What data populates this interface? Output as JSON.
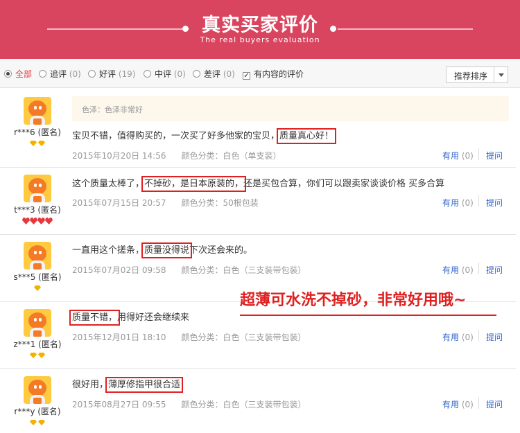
{
  "header": {
    "title": "真实买家评价",
    "subtitle": "The real buyers evaluation"
  },
  "filters": [
    {
      "label": "全部",
      "count": "",
      "selected": true
    },
    {
      "label": "追评",
      "count": "(0)",
      "selected": false
    },
    {
      "label": "好评",
      "count": "(19)",
      "selected": false
    },
    {
      "label": "中评",
      "count": "(0)",
      "selected": false
    },
    {
      "label": "差评",
      "count": "(0)",
      "selected": false
    }
  ],
  "content_filter": {
    "label": "有内容的评价",
    "checked": true
  },
  "sort": {
    "label": "推荐排序"
  },
  "reviews": [
    {
      "user": "r***6 (匿名)",
      "level": "diamond-2",
      "tag": "色泽：色泽非常好",
      "text_before": "宝贝不错，值得购买的，一次买了好多他家的宝贝，",
      "text_highlight": "质量真心好！",
      "text_after": "",
      "date": "2015年10月20日 14:56",
      "color": "颜色分类：白色（单支装）",
      "useful_label": "有用",
      "useful_count": "(0)",
      "reply_label": "提问"
    },
    {
      "user": "t***3 (匿名)",
      "level": "heart-4",
      "text_before": "这个质量太棒了，",
      "text_highlight": "不掉砂，是日本原装的，",
      "text_after": "还是买包合算，你们可以跟卖家谈谈价格 买多合算",
      "date": "2015年07月15日 20:57",
      "color": "颜色分类：50根包装",
      "useful_label": "有用",
      "useful_count": "(0)",
      "reply_label": "提问"
    },
    {
      "user": "s***5 (匿名)",
      "level": "diamond-1",
      "text_before": "一直用这个搓条，",
      "text_highlight": "质量没得说",
      "text_after": "下次还会来的。",
      "date": "2015年07月02日 09:58",
      "color": "颜色分类：白色（三支装带包装）",
      "useful_label": "有用",
      "useful_count": "(0)",
      "reply_label": "提问"
    },
    {
      "user": "z***1 (匿名)",
      "level": "diamond-2",
      "text_before": "",
      "text_highlight": "质量不错，",
      "text_after": "用得好还会继续来",
      "date": "2015年12月01日 18:10",
      "color": "颜色分类：白色（三支装带包装）",
      "useful_label": "有用",
      "useful_count": "(0)",
      "reply_label": "提问"
    },
    {
      "user": "r***y (匿名)",
      "level": "diamond-2",
      "text_before": "很好用，",
      "text_highlight": "薄厚修指甲很合适",
      "text_after": "",
      "date": "2015年08月27日 09:55",
      "color": "颜色分类：白色（三支装带包装）",
      "useful_label": "有用",
      "useful_count": "(0)",
      "reply_label": "提问"
    }
  ],
  "overlay_text": "超薄可水洗不掉砂，非常好用哦~",
  "colors": {
    "banner": "#d9445e",
    "highlight_box": "#e02020",
    "link": "#3366cc",
    "active_filter": "#e4393c"
  }
}
